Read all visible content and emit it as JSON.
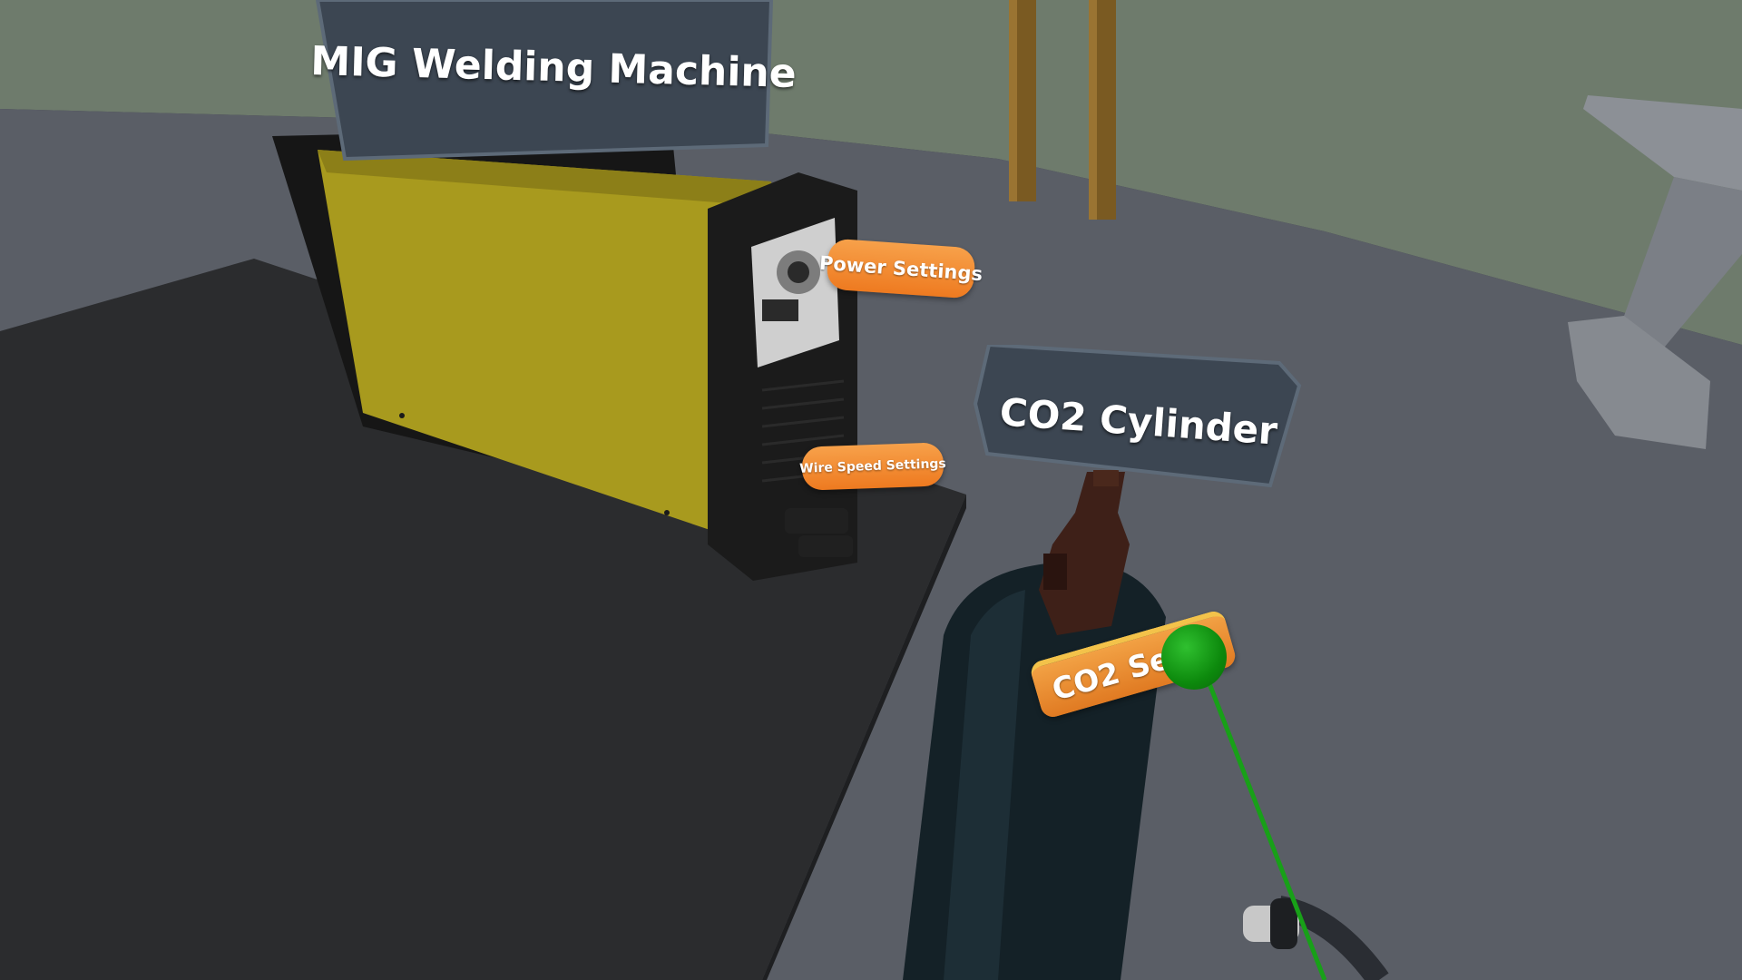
{
  "scene": {
    "machine_label": "MIG Welding Machine",
    "cylinder_label": "CO2 Cylinder"
  },
  "buttons": {
    "power_settings": "Power Settings",
    "wire_speed_settings": "Wire Speed Settings",
    "co2_settings": "CO2 Sett"
  },
  "colors": {
    "orange_button": "#ee7a20",
    "label_panel": "#3c4652",
    "machine_body": "#a89a1e",
    "pointer_ray": "#18a018"
  },
  "icons": {
    "controller_pointer": "green-sphere"
  }
}
